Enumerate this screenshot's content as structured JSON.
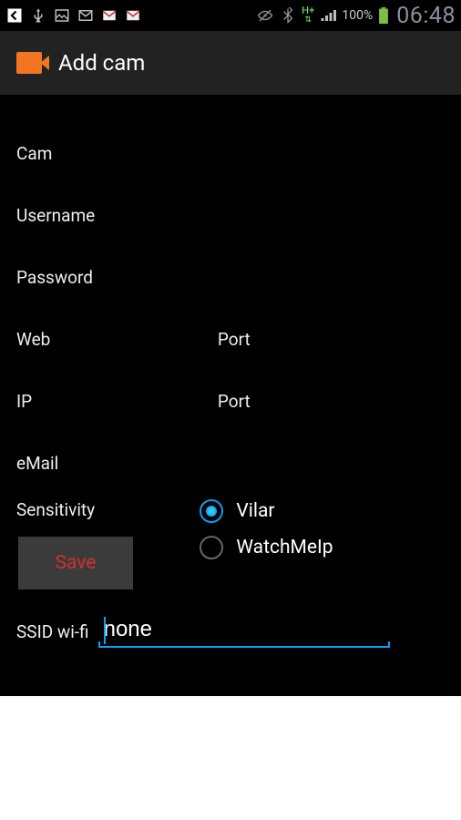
{
  "status": {
    "battery_pct": "100%",
    "clock": "06:48",
    "network": "H+"
  },
  "title": "Add cam",
  "form": {
    "cam_label": "Cam",
    "username_label": "Username",
    "password_label": "Password",
    "web_label": "Web",
    "web_port_label": "Port",
    "ip_label": "IP",
    "ip_port_label": "Port",
    "email_label": "eMail",
    "sensitivity_label": "Sensitivity",
    "radios": {
      "vilar": "Vilar",
      "watchmeip": "WatchMeIp"
    },
    "save_label": "Save",
    "ssid_label": "SSID wi-fi",
    "ssid_value": "none"
  }
}
